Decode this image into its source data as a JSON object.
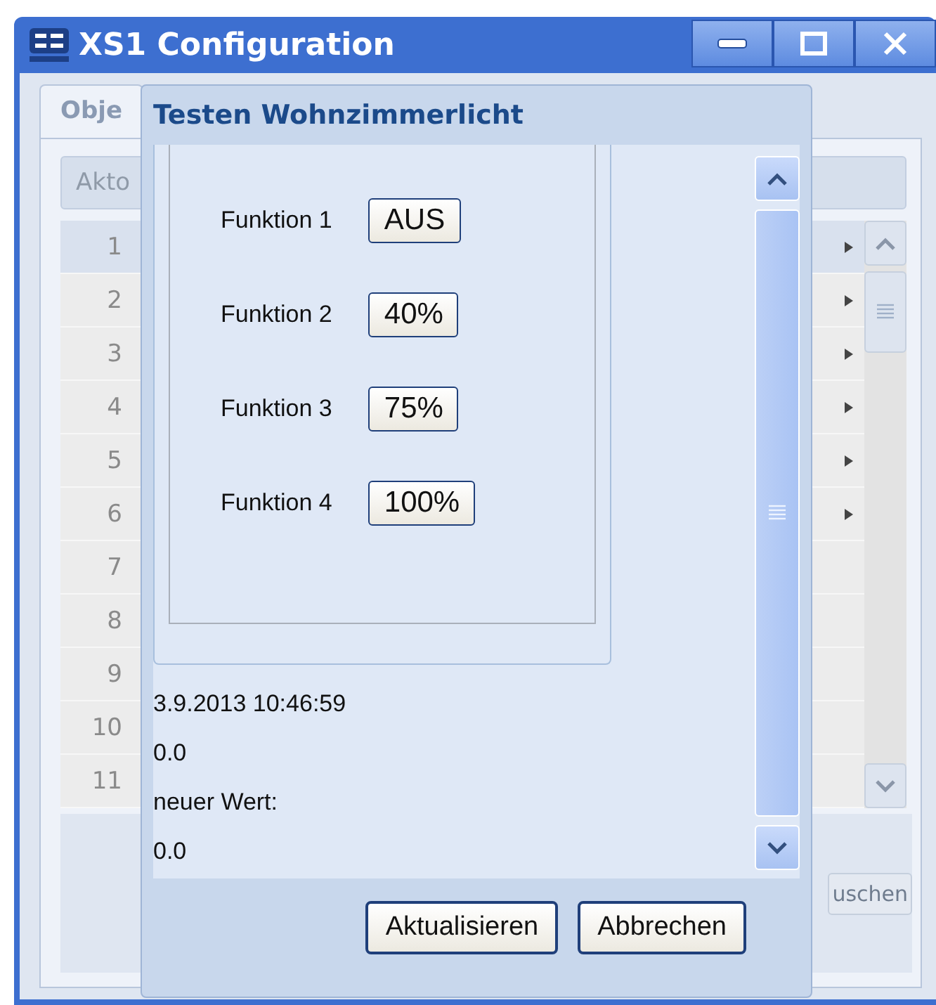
{
  "window": {
    "title": "XS1 Configuration"
  },
  "tabs": [
    {
      "label": "Obje",
      "selected": true
    }
  ],
  "table": {
    "header": "Akto",
    "rows": [
      {
        "number": "1",
        "selected": true,
        "marker": true
      },
      {
        "number": "2",
        "selected": false,
        "marker": true
      },
      {
        "number": "3",
        "selected": false,
        "marker": true
      },
      {
        "number": "4",
        "selected": false,
        "marker": true
      },
      {
        "number": "5",
        "selected": false,
        "marker": true
      },
      {
        "number": "6",
        "selected": false,
        "marker": true
      },
      {
        "number": "7",
        "selected": false,
        "marker": false
      },
      {
        "number": "8",
        "selected": false,
        "marker": false
      },
      {
        "number": "9",
        "selected": false,
        "marker": false
      },
      {
        "number": "10",
        "selected": false,
        "marker": false
      },
      {
        "number": "11",
        "selected": false,
        "marker": false
      }
    ]
  },
  "footer_button": "uschen",
  "dialog": {
    "title": "Testen Wohnzimmerlicht",
    "functions": [
      {
        "label": "Funktion 1",
        "button": "AUS"
      },
      {
        "label": "Funktion 2",
        "button": "40%"
      },
      {
        "label": "Funktion 3",
        "button": "75%"
      },
      {
        "label": "Funktion 4",
        "button": "100%"
      }
    ],
    "info_lines": [
      "3.9.2013 10:46:59",
      "0.0",
      "neuer Wert:",
      "0.0"
    ],
    "buttons": [
      "Aktualisieren",
      "Abbrechen"
    ]
  }
}
